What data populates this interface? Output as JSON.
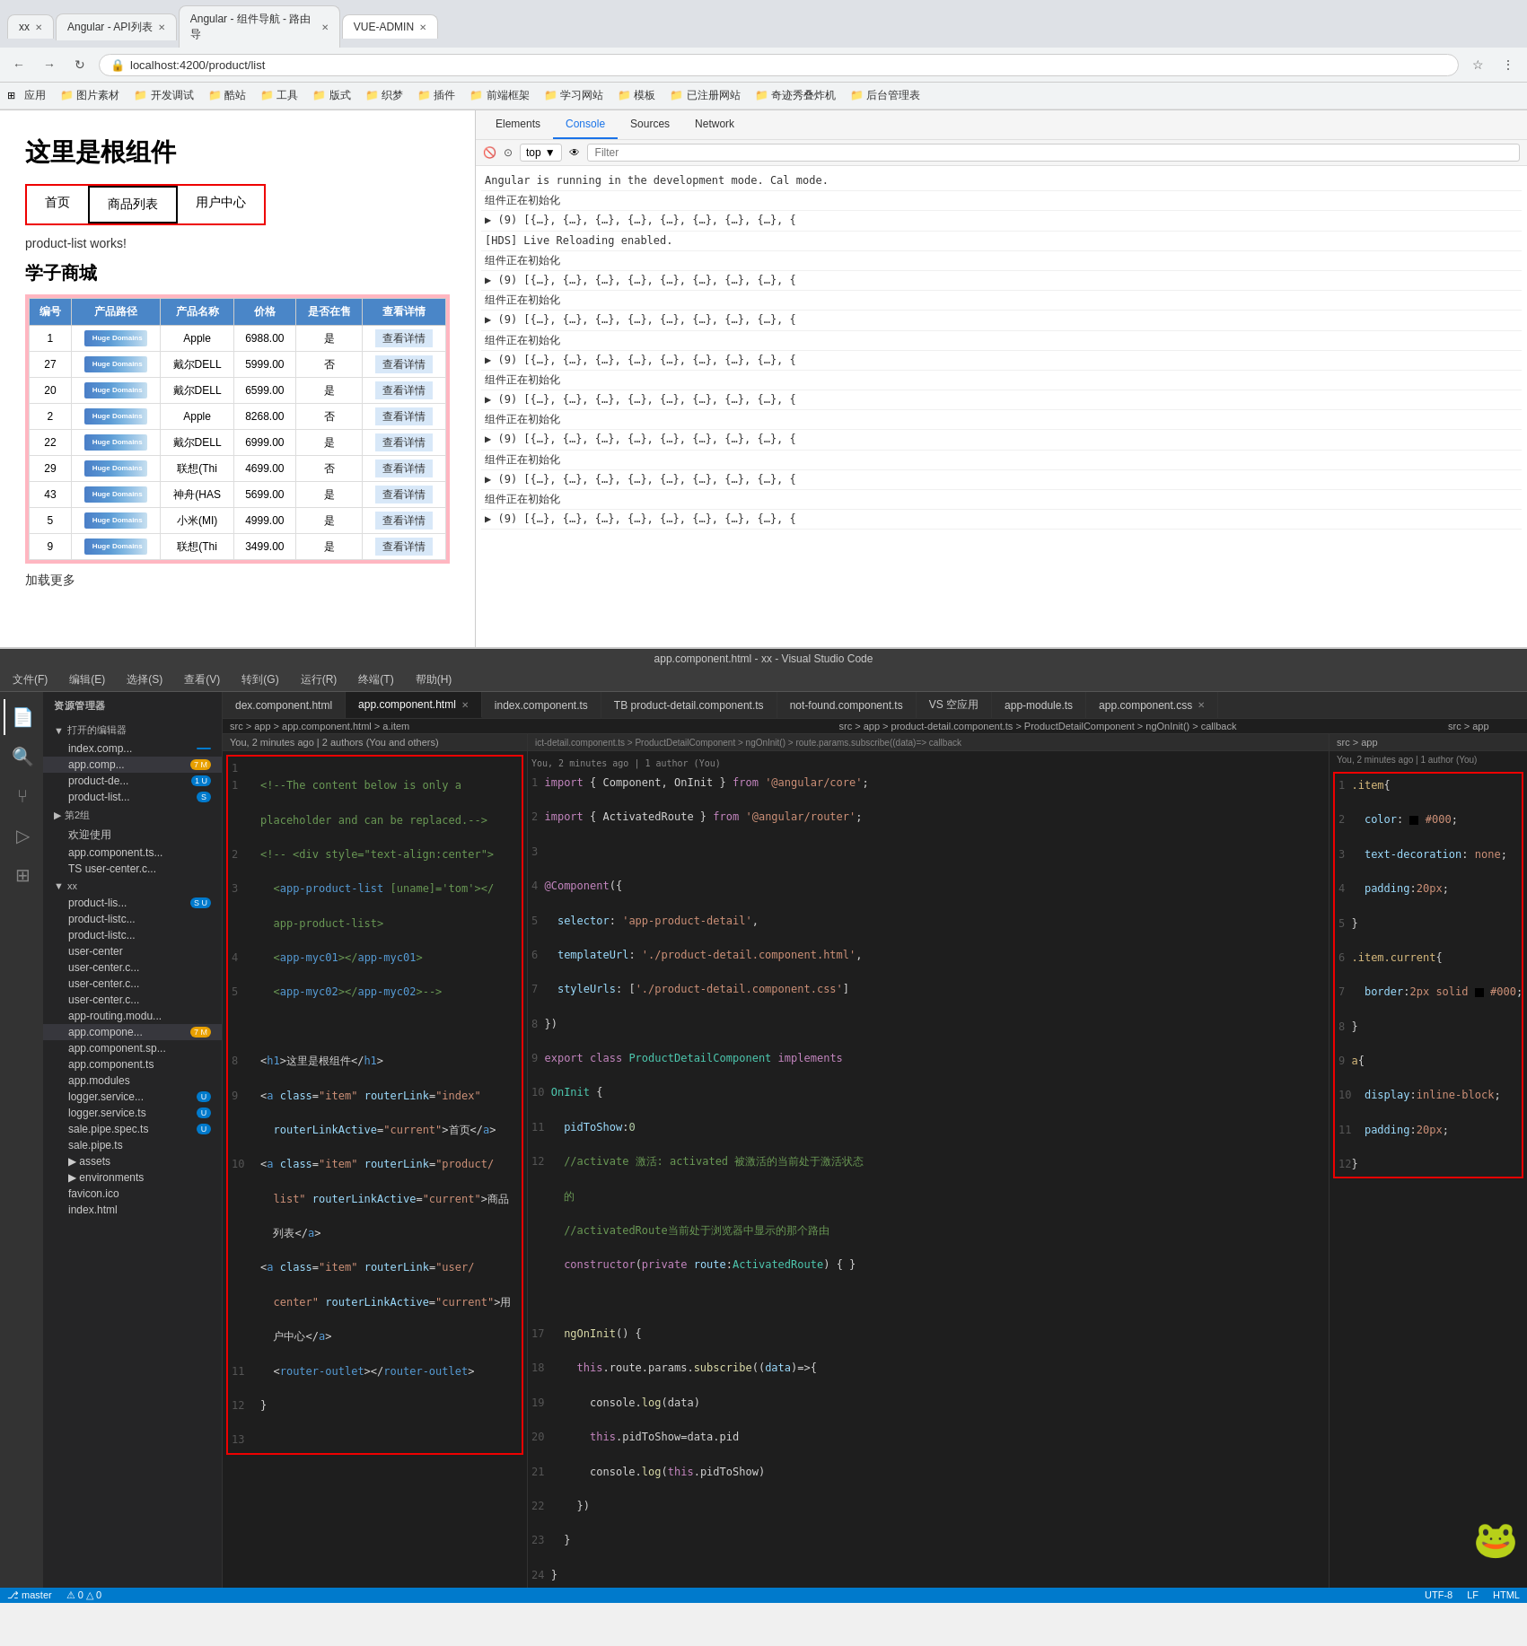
{
  "browser": {
    "tabs": [
      {
        "label": "xx",
        "active": false
      },
      {
        "label": "Angular - API列表",
        "active": false
      },
      {
        "label": "Angular - 组件导航 - 路由导 ×",
        "active": false
      },
      {
        "label": "VUE-ADMIN",
        "active": true
      }
    ],
    "address": "localhost:4200/product/list",
    "bookmarks": [
      "应用",
      "图片素材",
      "开发调试",
      "酷站",
      "工具",
      "版式",
      "织梦",
      "插件",
      "前端框架",
      "学习网站",
      "模板",
      "已注册网站",
      "奇迹秀叠炸机",
      "后台管理表"
    ]
  },
  "webpage": {
    "title": "这里是根组件",
    "nav_items": [
      "首页",
      "商品列表",
      "用户中心"
    ],
    "works_text": "product-list works!",
    "shop_title": "学子商城",
    "table": {
      "headers": [
        "编号",
        "产品路径",
        "产品名称",
        "价格",
        "是否在售",
        "查看详情"
      ],
      "rows": [
        {
          "id": "1",
          "img": "Huge Domains",
          "name": "Apple",
          "price": "6988.00",
          "available": "是",
          "detail": "查看详情"
        },
        {
          "id": "27",
          "img": "Huge Domains",
          "name": "戴尔DELL",
          "price": "5999.00",
          "available": "否",
          "detail": "查看详情"
        },
        {
          "id": "20",
          "img": "Huge Domains",
          "name": "戴尔DELL",
          "price": "6599.00",
          "available": "是",
          "detail": "查看详情"
        },
        {
          "id": "2",
          "img": "Huge Domains",
          "name": "Apple",
          "price": "8268.00",
          "available": "否",
          "detail": "查看详情"
        },
        {
          "id": "22",
          "img": "Huge Domains",
          "name": "戴尔DELL",
          "price": "6999.00",
          "available": "是",
          "detail": "查看详情"
        },
        {
          "id": "29",
          "img": "Huge Domains",
          "name": "联想(Thi",
          "price": "4699.00",
          "available": "否",
          "detail": "查看详情"
        },
        {
          "id": "43",
          "img": "Huge Domains",
          "name": "神舟(HAS",
          "price": "5699.00",
          "available": "是",
          "detail": "查看详情"
        },
        {
          "id": "5",
          "img": "Huge Domains",
          "name": "小米(MI)",
          "price": "4999.00",
          "available": "是",
          "detail": "查看详情"
        },
        {
          "id": "9",
          "img": "Huge Domains",
          "name": "联想(Thi",
          "price": "3499.00",
          "available": "是",
          "detail": "查看详情"
        }
      ]
    },
    "load_more": "加载更多"
  },
  "devtools": {
    "tabs": [
      "Elements",
      "Console",
      "Sources",
      "Network"
    ],
    "active_tab": "Console",
    "toolbar": {
      "top_label": "top",
      "filter_placeholder": "Filter"
    },
    "console_lines": [
      "Angular is running in the development mode. Cal mode.",
      "组件正在初始化",
      "▶ (9) [{…}, {…}, {…}, {…}, {…}, {…}, {…}, {…}, {",
      "[HDS] Live Reloading enabled.",
      "组件正在初始化",
      "▶ (9) [{…}, {…}, {…}, {…}, {…}, {…}, {…}, {…}, {",
      "组件正在初始化",
      "▶ (9) [{…}, {…}, {…}, {…}, {…}, {…}, {…}, {…}, {",
      "组件正在初始化",
      "▶ (9) [{…}, {…}, {…}, {…}, {…}, {…}, {…}, {…}, {",
      "组件正在初始化",
      "▶ (9) [{…}, {…}, {…}, {…}, {…}, {…}, {…}, {…}, {",
      "组件正在初始化",
      "▶ (9) [{…}, {…}, {…}, {…}, {…}, {…}, {…}, {…}, {",
      "组件正在初始化",
      "▶ (9) [{…}, {…}, {…}, {…}, {…}, {…}, {…}, {…}, {",
      "组件正在初始化",
      "▶ (9) [{…}, {…}, {…}, {…}, {…}, {…}, {…}, {…}, {"
    ]
  },
  "vscode": {
    "title": "app.component.html - xx - Visual Studio Code",
    "menubar": [
      "文件(F)",
      "编辑(E)",
      "选择(S)",
      "查看(V)",
      "转到(G)",
      "运行(R)",
      "终端(T)",
      "帮助(H)"
    ],
    "sidebar": {
      "header": "资源管理器",
      "sections": [
        {
          "name": "打开的编辑器",
          "files": [
            {
              "name": "index.comp...",
              "badge": ""
            },
            {
              "name": "app.comp...",
              "badge": "7 M"
            },
            {
              "name": "product-de...",
              "badge": "1 U"
            },
            {
              "name": "product-list...",
              "badge": "S"
            }
          ]
        },
        {
          "name": "第2组",
          "files": [
            {
              "name": "欢迎使用"
            },
            {
              "name": "app.component.ts..."
            },
            {
              "name": "TS user-center.c..."
            }
          ]
        },
        {
          "name": "xx",
          "files": [
            {
              "name": "product-lis...",
              "badge": "S U"
            },
            {
              "name": "product-listc...",
              "badge": ""
            },
            {
              "name": "product-listc...",
              "badge": ""
            },
            {
              "name": "user-center",
              "badge": ""
            },
            {
              "name": "user-center.c...",
              "badge": ""
            },
            {
              "name": "user-center.c...",
              "badge": ""
            },
            {
              "name": "user-center.c...",
              "badge": ""
            },
            {
              "name": "app-routing.modu...",
              "badge": ""
            },
            {
              "name": "app.compone...",
              "badge": "7 M"
            },
            {
              "name": "app.component.sp...",
              "badge": ""
            },
            {
              "name": "app.component.ts",
              "badge": ""
            },
            {
              "name": "app.modules",
              "badge": ""
            },
            {
              "name": "logger.service...",
              "badge": "U"
            },
            {
              "name": "logger.service.ts",
              "badge": "U"
            },
            {
              "name": "sale.pipe.spec.ts",
              "badge": "U"
            },
            {
              "name": "sale.pipe.ts",
              "badge": ""
            },
            {
              "name": "assets",
              "badge": ""
            },
            {
              "name": "environments",
              "badge": ""
            },
            {
              "name": "favicon.ico",
              "badge": ""
            },
            {
              "name": "index.html",
              "badge": ""
            }
          ]
        }
      ]
    },
    "editor_tabs": [
      {
        "name": "dex.component.html",
        "active": false
      },
      {
        "name": "app.component.html",
        "active": true,
        "modified": true
      },
      {
        "name": "index.component.ts",
        "active": false
      },
      {
        "name": "product-detail.component.ts",
        "active": false
      },
      {
        "name": "not-found.component.ts",
        "active": false
      },
      {
        "name": "VS 空应用",
        "active": false
      },
      {
        "name": "app-module.ts",
        "active": false
      },
      {
        "name": "app.component.css",
        "active": false
      }
    ],
    "breadcrumb": "src > app > app.component.html > a.item",
    "breadcrumb2": "src > app > product-detail.component.ts > ProductDetailComponent > ngOnInit() > callback",
    "breadcrumb3": "src > app",
    "html_code": {
      "author_line": "You, 2 minutes ago | 2 authors (You and others)",
      "lines": [
        "<!--The content below is only a placeholder and can be replaced.-->",
        "<!-- <div style=\"text-align:center\">",
        "  <app-product-list [uname]='tom'></",
        "  app-product-list>",
        "  <app-myc01></app-myc01>",
        "  <app-myc02></app-myc02>-->",
        "",
        "  <h1>这里是根组件</h1>",
        "  <a class=\"item\" routerLink=\"index\"",
        "    routerLinkActive=\"current\">首页</a>",
        "  <a class=\"item\" routerLink=\"product/",
        "    list\" routerLinkActive=\"current\">商品",
        "    列表</a>",
        "  <a class=\"item\" routerLink=\"user/",
        "    center\" routerLinkActive=\"current\">用",
        "    户中心</a>",
        "  <router-outlet></router-outlet>",
        "}"
      ]
    },
    "ts_code": {
      "author_line": "You, 2 minutes ago | 1 author (You)",
      "lines": [
        "import { Component, OnInit } from '@angular/core';",
        "import { ActivatedRoute } from '@angular/router';",
        "",
        "@Component({",
        "  selector: 'app-product-detail',",
        "  templateUrl: './product-detail.component.html',",
        "  styleUrls: ['./product-detail.component.css']",
        "})",
        "export class ProductDetailComponent implements",
        "OnInit {",
        "  pidToShow:0",
        "  //activate 激活: activated 被激活的当前处于激活状",
        "  态的",
        "  //activatedRoute当前处于浏览器中显示的那个路由",
        "  constructor(private route:ActivatedRoute) { }",
        "",
        "  ngOnInit() {",
        "    this.route.params.subscribe((data)=>{",
        "      console.log(data)",
        "      this.pidToShow=data.pid",
        "      console.log(this.pidToShow)",
        "    })",
        "  }",
        "}"
      ]
    },
    "css_code": {
      "author_line": "You, 2 minutes ago | 1 author (You)",
      "lines": [
        ".item{",
        "  color: #000;",
        "  text-decoration: none;",
        "  padding:20px;",
        "}",
        ".item.current{",
        "  border:2px solid #000;",
        "}",
        "a{",
        "  display:inline-block;",
        "  padding:20px;",
        "}"
      ]
    }
  }
}
